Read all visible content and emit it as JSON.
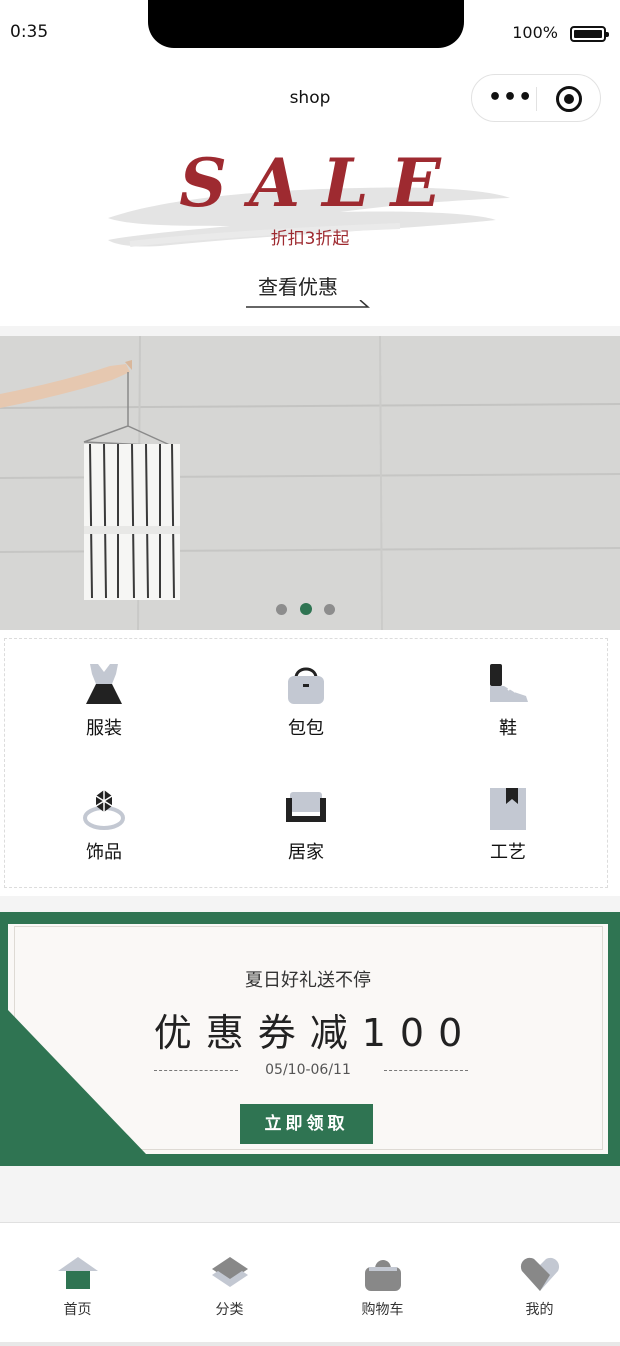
{
  "status_bar": {
    "time": "0:35",
    "battery": "100%"
  },
  "navbar": {
    "title": "shop",
    "more_label": "•••"
  },
  "sale": {
    "title": "SALE",
    "subtitle": "折扣3折起",
    "link": "查看优惠"
  },
  "banner": {
    "slides": 3,
    "active_slide": 2
  },
  "categories": [
    {
      "label": "服装",
      "icon": "dress-icon"
    },
    {
      "label": "包包",
      "icon": "bag-icon"
    },
    {
      "label": "鞋",
      "icon": "shoe-icon"
    },
    {
      "label": "饰品",
      "icon": "ring-icon"
    },
    {
      "label": "居家",
      "icon": "sofa-icon"
    },
    {
      "label": "工艺",
      "icon": "book-icon"
    }
  ],
  "coupon": {
    "tagline": "夏日好礼送不停",
    "headline": "优惠券减100",
    "date": "05/10-06/11",
    "button": "立即领取"
  },
  "tabs": [
    {
      "label": "首页",
      "icon": "home-icon",
      "active": true
    },
    {
      "label": "分类",
      "icon": "category-icon",
      "active": false
    },
    {
      "label": "购物车",
      "icon": "cart-icon",
      "active": false
    },
    {
      "label": "我的",
      "icon": "profile-icon",
      "active": false
    }
  ],
  "colors": {
    "accent": "#2f7452",
    "sale": "#9e2a30",
    "icon_gray": "#c3c8d2"
  }
}
